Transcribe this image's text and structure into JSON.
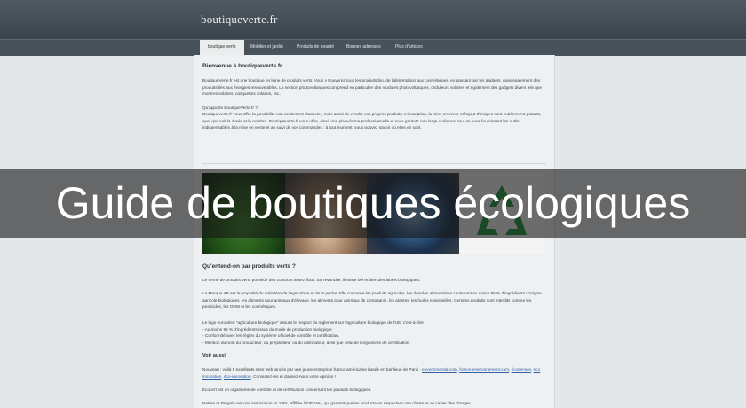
{
  "site": {
    "title": "boutiqueverte.fr"
  },
  "nav": {
    "items": [
      {
        "label": "boutique verte"
      },
      {
        "label": "Mobilier et jardin"
      },
      {
        "label": "Produits de beauté"
      },
      {
        "label": "Bonnes adresses"
      },
      {
        "label": "Plus d'articles"
      }
    ]
  },
  "intro": {
    "heading": "Bienvenue à boutiqueverte.fr",
    "p1": "BoutiqueVerte.fr est une boutique en ligne de produits verts. Vous y trouverez tous les produits bio, de l'alimentation aux cosmétiques, en passant par les gadgets, mais également des produits liés aux énergies renouvelables. La section photovoltaïques comprend en particulier des modules photovoltaïques, onduleurs solaires et également des gadgets divers tels que montres solaires, casquettes solaires, etc...",
    "p2_title": "Qu'apporte BoutiqueVerte.fr ?",
    "p2": "Boutiqueverte.fr vous offre la possibilité non seulement d'acheter, mais aussi de vendre vos propres produits. L'inscription, la mise en vente et l'ajout d'images sont entièrement gratuits, quel que soit la durée et le nombre. Boutiqueverte.fr vous offre, ainsi, une plate-forme professionnelle et vous garantit une large audience, tout en vous fournissant les outils indispensables à la mise en vente et au suivi de vos commandes : à tout moment, vous pouvez savoir où elles en sont."
  },
  "banner": {
    "text": "Guide de boutiques écologiques"
  },
  "article": {
    "heading": "Qu'entend-on par produits verts ?",
    "p1": "Le terme de produits verts possède des contours assez flous. En revanche, il existe bel et bien des labels biologiques.",
    "p2": "La Marque AB est la propriété du ministère de l'agriculture et de la pêche. Elle concerne les produits agricoles, les denrées alimentaires contenant au moins 95 % d'ingrédients d'origine agricole biologiques, les aliments pour animaux d'élevage, les aliments pour animaux de compagnie, les plantes, les huiles essentielles. Certains produits sont interdits comme les pesticides, les OGM et les cosmétiques.",
    "p3_lines": [
      "Le logo européen \"agriculture biologique\" assure le respect du règlement sur l'agriculture biologique de l'UE, c'est-à-dire :",
      "- Au moins 95 % d'ingrédients issus du mode de production biologique",
      "- Conformité avec les règles du système officiel de contrôle et certification,",
      "- Mention du nom du producteur, du préparateur ou du distributeur, ainsi que celui de l'organisme de certification."
    ],
    "voir_aussi": "Voir aussi",
    "nouveau_text": "Nouveau : voilà 5 excellents sites web lancés par une jeune entreprise franco-américaine basée en banlieue de Paris :",
    "links": [
      "environmental.com",
      "france-environnement.com",
      "écoservice",
      "eco innovation",
      "éco-innovation"
    ],
    "nouveau_end": "Consultez-les et donnez-nous votre opinion !",
    "ecocert": "Ecocert est un  organisme de contrôle et de certification concernant les produits biologiques.",
    "nature": "Nature et Progrès est une association loi 1901, affiliée à l'IFOAM, qui garantit que les producteurs respectent une charte et un cahier des charges."
  }
}
